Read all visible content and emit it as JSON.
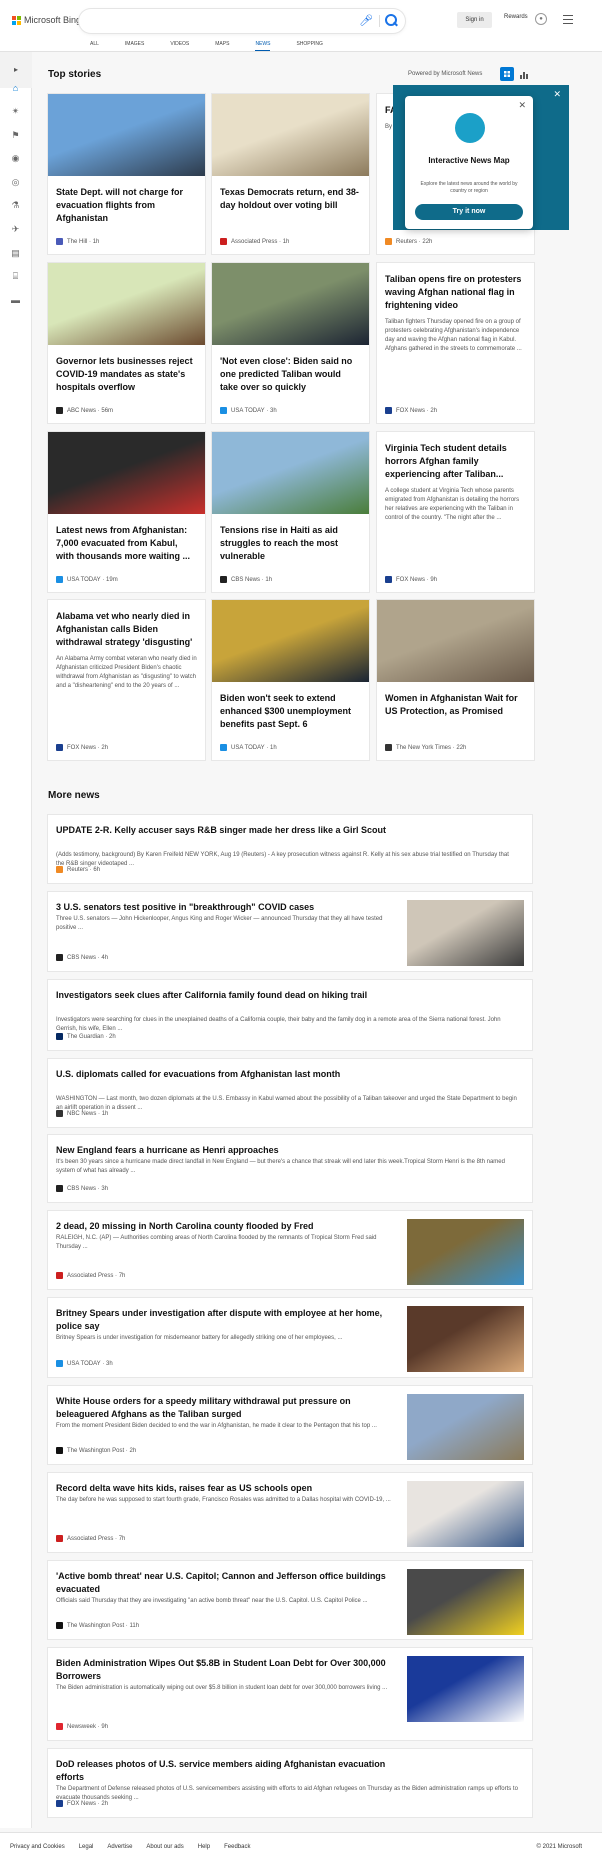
{
  "header": {
    "brand": "Microsoft Bing",
    "sign_in": "Sign in",
    "rewards": "Rewards",
    "tabs": [
      "ALL",
      "IMAGES",
      "VIDEOS",
      "MAPS",
      "NEWS",
      "SHOPPING"
    ],
    "active_tab": "NEWS",
    "brand_colors": [
      "#f25022",
      "#7fba00",
      "#00a4ef",
      "#ffb900"
    ],
    "accent": "#0078d4"
  },
  "sidebar": {
    "icons": [
      "chevron-right-icon",
      "home-icon",
      "virus-icon",
      "flag-icon",
      "location-icon",
      "globe-icon",
      "microscope-icon",
      "rocket-icon",
      "film-icon",
      "bank-icon",
      "money-icon"
    ]
  },
  "top_stories": {
    "title": "Top stories",
    "powered_by": "Powered by Microsoft News",
    "cards": [
      {
        "title": "State Dept. will not charge for evacuation flights from Afghanistan",
        "snippet": "",
        "source": "The Hill",
        "time": "1h",
        "source_color": "#4a5ab8",
        "image_colors": [
          "#6ba2d8",
          "#2d3b4c"
        ]
      },
      {
        "title": "Texas Democrats return, end 38-day holdout over voting bill",
        "snippet": "",
        "source": "Associated Press",
        "time": "1h",
        "source_color": "#cc1f1f",
        "image_colors": [
          "#e8dfc8",
          "#8c7a5c"
        ]
      },
      {
        "title": "FAA... op... Fl...",
        "snippet": "By ... (Reuters) Administration ... that do... can fly",
        "source": "Reuters",
        "time": "22h",
        "source_color": "#f08a24",
        "image_colors": []
      },
      {
        "title": "Governor lets businesses reject COVID-19 mandates as state's hospitals overflow",
        "snippet": "",
        "source": "ABC News",
        "time": "56m",
        "source_color": "#222222",
        "image_colors": [
          "#d8e6b8",
          "#6b4a2f"
        ]
      },
      {
        "title": "'Not even close': Biden said no one predicted Taliban would take over so quickly",
        "snippet": "",
        "source": "USA TODAY",
        "time": "3h",
        "source_color": "#1a8fe3",
        "image_colors": [
          "#7d8f6a",
          "#1c2433"
        ]
      },
      {
        "title": "Taliban opens fire on protesters waving Afghan national flag in frightening video",
        "snippet": "Taliban fighters Thursday opened fire on a group of protesters celebrating Afghanistan's independence day and waving the Afghan national flag in Kabul.  Afghans gathered in the streets to commemorate ...",
        "source": "FOX News",
        "time": "2h",
        "source_color": "#1a3f8f",
        "image_colors": []
      },
      {
        "title": "Latest news from Afghanistan: 7,000 evacuated from Kabul, with thousands more waiting ...",
        "snippet": "",
        "source": "USA TODAY",
        "time": "19m",
        "source_color": "#1a8fe3",
        "image_colors": [
          "#2a2a2a",
          "#c9302c"
        ]
      },
      {
        "title": "Tensions rise in Haiti as aid struggles to reach the most vulnerable",
        "snippet": "",
        "source": "CBS News",
        "time": "1h",
        "source_color": "#222222",
        "image_colors": [
          "#8fb8d8",
          "#4a7d3a"
        ]
      },
      {
        "title": "Virginia Tech student details horrors Afghan family experiencing after Taliban...",
        "snippet": "A college student at Virginia Tech whose parents emigrated from Afghanistan is detailing the horrors her relatives are experiencing with the Taliban in control of the country.  \"The night after the ...",
        "source": "FOX News",
        "time": "9h",
        "source_color": "#1a3f8f",
        "image_colors": []
      },
      {
        "title": "Alabama vet who nearly died in Afghanistan calls Biden withdrawal strategy 'disgusting'",
        "snippet": "An Alabama Army combat veteran who nearly died in Afghanistan criticized President Biden's chaotic withdrawal from Afghanistan as \"disgusting\" to watch and a \"disheartening\" end to the 20 years of ...",
        "source": "FOX News",
        "time": "2h",
        "source_color": "#1a3f8f",
        "image_colors": []
      },
      {
        "title": "Biden won't seek to extend enhanced $300 unemployment benefits past Sept. 6",
        "snippet": "",
        "source": "USA TODAY",
        "time": "1h",
        "source_color": "#1a8fe3",
        "image_colors": [
          "#c8a43a",
          "#1a2433"
        ]
      },
      {
        "title": "Women in Afghanistan Wait for US Protection, as Promised",
        "snippet": "",
        "source": "The New York Times",
        "time": "22h",
        "source_color": "#333333",
        "image_colors": [
          "#b0a48c",
          "#6a5a4a"
        ]
      }
    ]
  },
  "popup": {
    "title": "Interactive News Map",
    "subtitle": "Explore the latest news around the world by country or region",
    "button": "Try it now",
    "color": "#0f6b8a"
  },
  "more_news": {
    "title": "More news",
    "items": [
      {
        "title": "UPDATE 2-R. Kelly accuser says R&B singer made her dress like a Girl Scout",
        "snippet": "(Adds testimony, background) By Karen Freifeld NEW YORK, Aug 19 (Reuters) - A key prosecution witness against R. Kelly at his sex abuse trial testified on Thursday that the R&B singer videotaped ...",
        "source": "Reuters",
        "time": "6h",
        "source_color": "#f08a24",
        "image_colors": []
      },
      {
        "title": "3 U.S. senators test positive in \"breakthrough\" COVID cases",
        "snippet": "Three U.S. senators — John Hickenlooper, Angus King and Roger Wicker — announced Thursday that they all have tested positive ...",
        "source": "CBS News",
        "time": "4h",
        "source_color": "#222222",
        "image_colors": [
          "#cfc6b8",
          "#3a3a3a"
        ]
      },
      {
        "title": "Investigators seek clues after California family found dead on hiking trail",
        "snippet": "Investigators were searching for clues in the unexplained deaths of a California couple, their baby and the family dog in a remote area of the Sierra national forest. John Gerrish, his wife, Ellen ...",
        "source": "The Guardian",
        "time": "2h",
        "source_color": "#052962",
        "image_colors": []
      },
      {
        "title": "U.S. diplomats called for evacuations from Afghanistan last month",
        "snippet": "WASHINGTON — Last month, two dozen diplomats at the U.S. Embassy in Kabul warned about the possibility of a Taliban takeover and urged the State Department to begin an airlift operation in a dissent ...",
        "source": "NBC News",
        "time": "1h",
        "source_color": "#333333",
        "image_colors": []
      },
      {
        "title": "New England fears a hurricane as Henri approaches",
        "snippet": "It's been 30 years since a hurricane made direct landfall in New England — but there's a chance that streak will end later this week.Tropical Storm Henri is the 8th named system of what has already ...",
        "source": "CBS News",
        "time": "3h",
        "source_color": "#222222",
        "image_colors": []
      },
      {
        "title": "2 dead, 20 missing in North Carolina county flooded by Fred",
        "snippet": "RALEIGH, N.C. (AP) — Authorities combing areas of North Carolina flooded by the remnants of Tropical Storm Fred said Thursday ...",
        "source": "Associated Press",
        "time": "7h",
        "source_color": "#cc1f1f",
        "image_colors": [
          "#7d6a3a",
          "#3a8fc8"
        ]
      },
      {
        "title": "Britney Spears under investigation after dispute with employee at her home, police say",
        "snippet": "Britney Spears is under investigation for misdemeanor battery for allegedly striking one of her employees, ...",
        "source": "USA TODAY",
        "time": "3h",
        "source_color": "#1a8fe3",
        "image_colors": [
          "#5a3a2a",
          "#d8a878"
        ]
      },
      {
        "title": "White House orders for a speedy military withdrawal put pressure on beleaguered Afghans as the Taliban surged",
        "snippet": "From the moment President Biden decided to end the war in Afghanistan, he made it clear to the Pentagon that his top ...",
        "source": "The Washington Post",
        "time": "2h",
        "source_color": "#111111",
        "image_colors": [
          "#8fa8c8",
          "#8a7a5a"
        ]
      },
      {
        "title": "Record delta wave hits kids, raises fear as US schools open",
        "snippet": "The day before he was supposed to start fourth grade, Francisco Rosales was admitted to a Dallas hospital with COVID-19, ...",
        "source": "Associated Press",
        "time": "7h",
        "source_color": "#cc1f1f",
        "image_colors": [
          "#e8e4e0",
          "#3a5a8a"
        ]
      },
      {
        "title": "'Active bomb threat' near U.S. Capitol; Cannon and Jefferson office buildings evacuated",
        "snippet": "Officials said Thursday that they are investigating \"an active bomb threat\" near the U.S. Capitol. U.S. Capitol Police ...",
        "source": "The Washington Post",
        "time": "11h",
        "source_color": "#111111",
        "image_colors": [
          "#4a4a4a",
          "#f0d020"
        ]
      },
      {
        "title": "Biden Administration Wipes Out $5.8B in Student Loan Debt for Over 300,000 Borrowers",
        "snippet": "The Biden administration is automatically wiping out over $5.8 billion in student loan debt for over 300,000 borrowers living ...",
        "source": "Newsweek",
        "time": "9h",
        "source_color": "#e0262f",
        "image_colors": [
          "#1a3a9a",
          "#ffffff"
        ]
      },
      {
        "title": "DoD releases photos of U.S. service members aiding Afghanistan evacuation efforts",
        "snippet": "The Department of Defense released photos of U.S. servicemembers assisting with efforts to aid Afghan refugees on Thursday as the Biden administration ramps up efforts to evacuate thousands seeking ...",
        "source": "FOX News",
        "time": "2h",
        "source_color": "#1a3f8f",
        "image_colors": []
      }
    ]
  },
  "footer": {
    "links": [
      "Privacy and Cookies",
      "Legal",
      "Advertise",
      "About our ads",
      "Help",
      "Feedback"
    ],
    "copyright": "© 2021 Microsoft"
  }
}
